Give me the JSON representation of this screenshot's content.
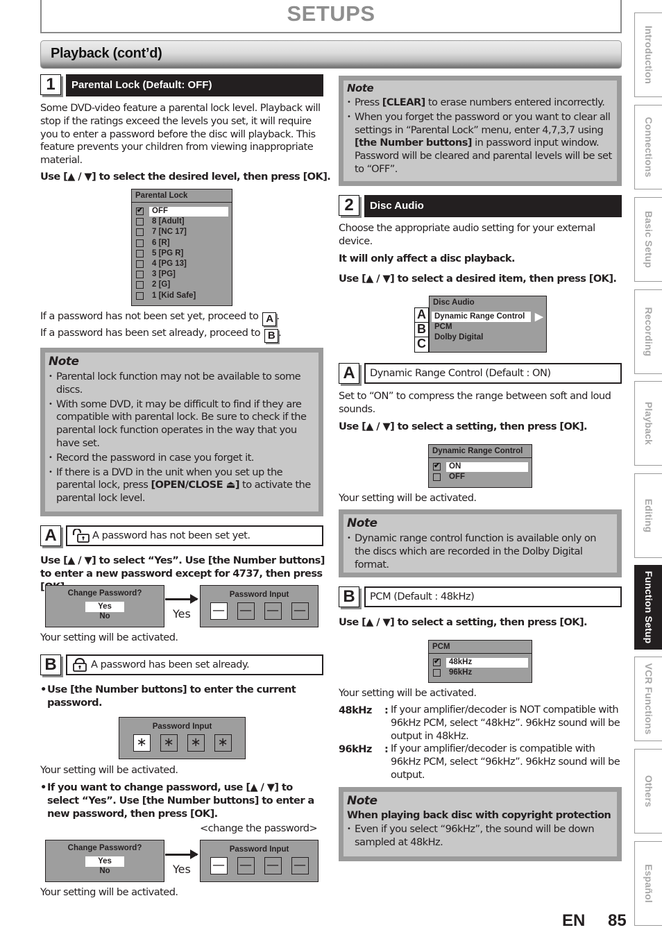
{
  "header": {
    "title": "SETUPS",
    "section": "Playback (cont’d)"
  },
  "side_tabs": [
    {
      "label": "Introduction",
      "active": false
    },
    {
      "label": "Connections",
      "active": false
    },
    {
      "label": "Basic Setup",
      "active": false
    },
    {
      "label": "Recording",
      "active": false
    },
    {
      "label": "Playback",
      "active": false
    },
    {
      "label": "Editing",
      "active": false
    },
    {
      "label": "Function Setup",
      "active": true
    },
    {
      "label": "VCR Functions",
      "active": false
    },
    {
      "label": "Others",
      "active": false
    },
    {
      "label": "Español",
      "active": false
    }
  ],
  "step1": {
    "number": "1",
    "title": "Parental Lock (Default: OFF)",
    "intro": "Some DVD-video feature a parental lock level. Playback will stop if the ratings exceed the levels you set, it will require you to enter a password before the disc will playback. This feature prevents your children from viewing inappropriate material.",
    "instruction": "Use [▲ / ▼] to select the desired level, then press [OK].",
    "menu": {
      "title": "Parental Lock",
      "items": [
        "OFF",
        "8 [Adult]",
        "7 [NC 17]",
        "6 [R]",
        "5 [PG R]",
        "4 [PG 13]",
        "3 [PG]",
        "2 [G]",
        "1 [Kid Safe]"
      ],
      "selected": "OFF"
    },
    "proceed_a_text": "If a password has not been set yet, proceed to",
    "proceed_a_letter": "A",
    "proceed_b_text": "If a password has been set already, proceed to",
    "proceed_b_letter": "B",
    "period": ".",
    "note": {
      "title": "Note",
      "items": [
        "Parental lock function may not be available to some discs.",
        "With some DVD, it may be difficult to find if they are compatible with parental lock. Be sure to check if the parental lock function operates in the way that you have set.",
        "Record the password in case you forget it."
      ],
      "last_item_pre": "If there is a DVD in the unit when you set up the parental lock, press ",
      "last_item_bold": "[OPEN/CLOSE ⏏]",
      "last_item_post": " to activate the parental lock level."
    },
    "sub_a": {
      "letter": "A",
      "label": "A password has not been set yet.",
      "icon": "unlocked-padlock-icon",
      "instruction": "Use [▲ / ▼] to select “Yes”. Use [the Number buttons] to enter a new password except for 4737, then press [OK].",
      "dialog_title": "Change Password?",
      "options": [
        "Yes",
        "No"
      ],
      "arrow_label": "Yes",
      "input_title": "Password Input",
      "cells": [
        "—",
        "—",
        "—",
        "—"
      ],
      "result": "Your setting will be activated."
    },
    "sub_b": {
      "letter": "B",
      "label": "A password has been set already.",
      "icon": "locked-padlock-icon",
      "instruction1": "Use [the Number buttons] to enter the current password.",
      "input_title": "Password Input",
      "cells": [
        "∗",
        "∗",
        "∗",
        "∗"
      ],
      "result1": "Your setting will be activated.",
      "instruction2": "If you want to change password, use [▲ / ▼] to select “Yes”. Use [the Number buttons] to enter a new password, then press [OK].",
      "caption": "<change the password>",
      "dialog_title": "Change Password?",
      "options": [
        "Yes",
        "No"
      ],
      "arrow_label": "Yes",
      "input_title2": "Password Input",
      "cells2": [
        "—",
        "—",
        "—",
        "—"
      ],
      "result2": "Your setting will be activated."
    }
  },
  "right_note": {
    "title": "Note",
    "item1_pre": "Press ",
    "item1_bold": "[CLEAR]",
    "item1_post": " to erase numbers entered incorrectly.",
    "item2_pre": "When you forget the password or you want to clear all settings in “Parental Lock” menu, enter 4,7,3,7 using ",
    "item2_bold": "[the Number buttons]",
    "item2_post": " in password input window. Password will be cleared and parental levels will be set to “OFF”."
  },
  "step2": {
    "number": "2",
    "title": "Disc Audio",
    "intro": "Choose the appropriate audio setting for your external device.",
    "bold1": "It will only affect a disc playback.",
    "instruction": "Use [▲ / ▼] to select a desired item, then press [OK].",
    "menu": {
      "title": "Disc Audio",
      "items": [
        "Dynamic Range Control",
        "PCM",
        "Dolby Digital"
      ],
      "letters": [
        "A",
        "B",
        "C"
      ],
      "selected": "Dynamic Range Control"
    },
    "sub_a": {
      "letter": "A",
      "label": "Dynamic Range Control (Default : ON)",
      "desc": "Set to “ON” to compress the range between soft and loud sounds.",
      "instruction": "Use [▲ / ▼] to select a setting, then press [OK].",
      "menu_title": "Dynamic Range Control",
      "items": [
        "ON",
        "OFF"
      ],
      "selected": "ON",
      "result": "Your setting will be activated.",
      "note_title": "Note",
      "note_item": "Dynamic range control function is available only on the discs which are recorded in the Dolby Digital format."
    },
    "sub_b": {
      "letter": "B",
      "label": "PCM (Default : 48kHz)",
      "instruction": "Use [▲ / ▼] to select a setting, then press [OK].",
      "menu_title": "PCM",
      "items": [
        "48kHz",
        "96kHz"
      ],
      "selected": "48kHz",
      "result": "Your setting will be activated.",
      "defs": [
        {
          "term": "48kHz",
          "sep": ":",
          "desc": "If your amplifier/decoder is NOT compatible with 96kHz PCM, select “48kHz”. 96kHz sound will be output in 48kHz."
        },
        {
          "term": "96kHz",
          "sep": ":",
          "desc": "If your amplifier/decoder is compatible with 96kHz PCM, select “96kHz”. 96kHz sound will be output."
        }
      ],
      "note_title": "Note",
      "note_sub": "When playing back disc with copyright protection",
      "note_item": "Even if you select “96kHz”, the sound will be down sampled at 48kHz."
    }
  },
  "footer": {
    "lang": "EN",
    "page": "85"
  }
}
